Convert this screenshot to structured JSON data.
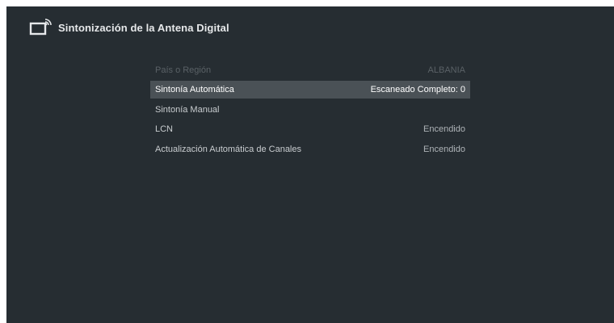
{
  "header": {
    "icon": "tv-antenna-icon",
    "title": "Sintonización de la Antena Digital"
  },
  "menu": {
    "items": [
      {
        "label": "País o Región",
        "value": "ALBANIA",
        "state": "disabled"
      },
      {
        "label": "Sintonía Automática",
        "value": "Escaneado Completo: 0",
        "state": "selected"
      },
      {
        "label": "Sintonía Manual",
        "value": "",
        "state": "normal"
      },
      {
        "label": "LCN",
        "value": "Encendido",
        "state": "normal"
      },
      {
        "label": "Actualización Automática de Canales",
        "value": "Encendido",
        "state": "normal"
      }
    ]
  },
  "colors": {
    "background": "#262d32",
    "selected_row": "#4a5156",
    "text": "#c9cdd0",
    "disabled_text": "#5a6166"
  }
}
